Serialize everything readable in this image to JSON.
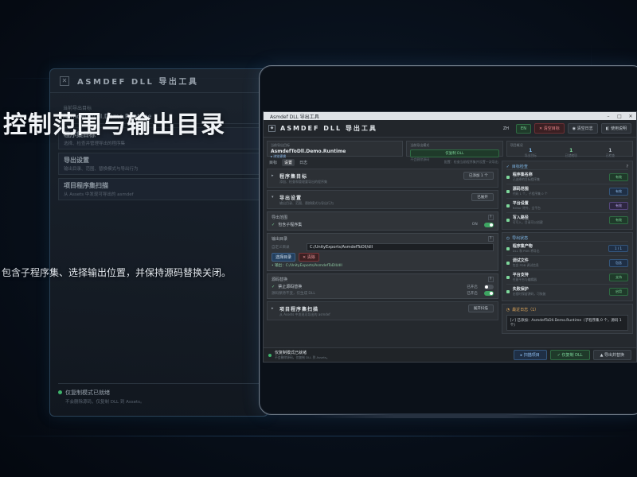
{
  "overlay": {
    "headline": "控制范围与输出目录",
    "caption": "包含子程序集、选择输出位置，并保持源码替换关闭。"
  },
  "ghost": {
    "title": "ASMDEF DLL 导出工具",
    "target_label": "当前导出目标",
    "target_value": "AsmdefToDll.Demo.Runtime",
    "rows": [
      {
        "title": "程序集目标",
        "sub": "选择、检查并管理导出的程序集"
      },
      {
        "title": "导出设置",
        "sub": "输出目录、范围、替换模式与导出行为"
      },
      {
        "title": "项目程序集扫描",
        "sub": "从 Assets 中发现可导出的 asmdef"
      }
    ],
    "footer_title": "仅复制模式已就绪",
    "footer_sub": "不会删除源码，仅复制 DLL 到 Assets。"
  },
  "window": {
    "os_title": "Asmdef DLL 导出工具",
    "os_controls": [
      "–",
      "□",
      "✕"
    ],
    "app_title": "ASMDEF DLL 导出工具",
    "lang_zh": "ZH",
    "lang_en": "EN",
    "clear_btn": "✕ 清空目标",
    "log_btn": "◉ 清空日志",
    "help_btn": "◧ 使用说明",
    "info": {
      "target_label": "当前导出目标",
      "target_value": "AsmdefToDll.Demo.Runtime",
      "target_link": "▸ 浏览更换",
      "mode_label": "当前导出模式",
      "mode_value": "仅复制 DLL",
      "mode_sub": "不会删除源码",
      "stats_label": "项目概况",
      "stats": [
        {
          "n": "1",
          "c": "导出目标"
        },
        {
          "n": "1",
          "c": "已就绪项"
        },
        {
          "n": "1",
          "c": "已检查"
        }
      ]
    },
    "tabs": [
      "目标",
      "设置",
      "日志"
    ],
    "tabs_hint": "配置：检查当前程序集并设置一次导出",
    "sections": {
      "target": {
        "title": "程序集目标",
        "sub": "添加、检查和管理要导出的程序集",
        "badge": "已添加 1 个"
      },
      "settings": {
        "title": "导出设置",
        "sub": "输出目录、范围、替换模式与导出行为",
        "badge": "已展开"
      },
      "scope": {
        "title": "导出范围",
        "include_label": "包含子程序集",
        "include_state": "ON"
      },
      "output": {
        "title": "输出目录",
        "field_label": "自定义目录",
        "path": "C:/UnityExports/AsmdefToDll/dll",
        "choose_btn": "选择目录",
        "clear_btn": "✕ 清除",
        "resolved": "• 输出：C:/UnityExports/AsmdefToDll/dll"
      },
      "replace": {
        "title": "源码替换",
        "disable_label": "禁止源码替换",
        "disable_state": "已开启",
        "hint": "源码保持不变，仅生成 DLL",
        "hint_state": "已开启"
      },
      "scan": {
        "title": "项目程序集扫描",
        "sub": "从 Assets 中发现可导出的 asmdef",
        "badge": "展开扫描"
      }
    },
    "right": {
      "target_header": "目标检查",
      "target_items": [
        {
          "title": "程序集名称",
          "sub": "已选择的目标程序集",
          "chip": "有效",
          "kind": "green"
        },
        {
          "title": "源码范围",
          "sub": "代码 1 个，子程序集 0 个",
          "chip": "有效",
          "kind": "blue"
        },
        {
          "title": "平台设置",
          "sub": "Editor 除外，全平台",
          "chip": "有效",
          "kind": "violet"
        },
        {
          "title": "写入路径",
          "sub": "可写入，目录可以创建",
          "chip": "有效",
          "kind": "green"
        }
      ],
      "export_header": "导出状态",
      "export_items": [
        {
          "title": "程序集产物",
          "sub": "DLL 和 PDB 将导出",
          "chip": "1 / 1",
          "kind": "blue"
        },
        {
          "title": "调试文件",
          "sub": "包含 PDB 调试信息",
          "chip": "包含",
          "kind": "blue"
        },
        {
          "title": "平台支持",
          "sub": "任意平台与编辑器",
          "chip": "支持",
          "kind": "green"
        },
        {
          "title": "失败保护",
          "sub": "出错时保留源码，可恢复",
          "chip": "启用",
          "kind": "green"
        }
      ],
      "log_header": "最近日志（1）",
      "log_entry": "[✓] 已添加：AsmdefToDll.Demo.Runtime（子程序集 0 个，源码 1 个）"
    },
    "footer": {
      "status_title": "仅复制模式已就绪",
      "status_sub": "不会删除源码，仅复制 DLL 到 Assets。",
      "scan_btn": "▸ 扫描项目",
      "export_btn": "✓ 仅复制 DLL",
      "replace_btn": "▲ 导出并替换"
    }
  }
}
